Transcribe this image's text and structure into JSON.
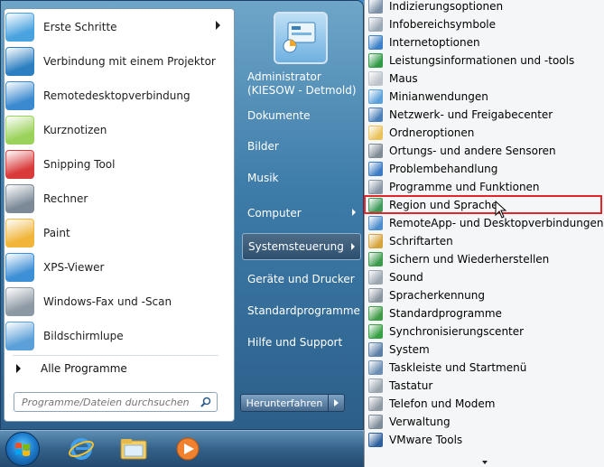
{
  "start_menu": {
    "programs": [
      {
        "label": "Erste Schritte",
        "icon": "getting-started-icon",
        "color": "#4aa3df",
        "has_submenu": true
      },
      {
        "label": "Verbindung mit einem Projektor",
        "icon": "projector-icon",
        "color": "#2d7fc1",
        "has_submenu": false
      },
      {
        "label": "Remotedesktopverbindung",
        "icon": "remote-desktop-icon",
        "color": "#3b8ad0",
        "has_submenu": false
      },
      {
        "label": "Kurznotizen",
        "icon": "sticky-notes-icon",
        "color": "#9bd25b",
        "has_submenu": false
      },
      {
        "label": "Snipping Tool",
        "icon": "scissors-icon",
        "color": "#d93a3a",
        "has_submenu": false
      },
      {
        "label": "Rechner",
        "icon": "calculator-icon",
        "color": "#7c8a98",
        "has_submenu": false
      },
      {
        "label": "Paint",
        "icon": "paint-palette-icon",
        "color": "#f0b53a",
        "has_submenu": false
      },
      {
        "label": "XPS-Viewer",
        "icon": "xps-viewer-icon",
        "color": "#3d8fd6",
        "has_submenu": false
      },
      {
        "label": "Windows-Fax und -Scan",
        "icon": "fax-icon",
        "color": "#8c98a3",
        "has_submenu": false
      },
      {
        "label": "Bildschirmlupe",
        "icon": "magnifier-icon",
        "color": "#5ba0d8",
        "has_submenu": false
      }
    ],
    "all_programs": "Alle Programme",
    "search_placeholder": "Programme/Dateien durchsuchen",
    "username": "Administrator\n(KIESOW - Detmold)",
    "right_links": [
      {
        "label": "Dokumente",
        "has_submenu": false,
        "highlighted": false
      },
      {
        "label": "Bilder",
        "has_submenu": false,
        "highlighted": false
      },
      {
        "label": "Musik",
        "has_submenu": false,
        "highlighted": false
      },
      {
        "label": "Computer",
        "has_submenu": true,
        "highlighted": false
      },
      {
        "label": "Systemsteuerung",
        "has_submenu": true,
        "highlighted": true
      },
      {
        "label": "Geräte und Drucker",
        "has_submenu": false,
        "highlighted": false
      },
      {
        "label": "Standardprogramme",
        "has_submenu": false,
        "highlighted": false
      },
      {
        "label": "Hilfe und Support",
        "has_submenu": false,
        "highlighted": false
      }
    ],
    "shutdown_label": "Herunterfahren"
  },
  "control_panel_menu": {
    "items": [
      {
        "label": "Indizierungsoptionen",
        "color": "#7b8fa6"
      },
      {
        "label": "Infobereichsymbole",
        "color": "#9aa7b5"
      },
      {
        "label": "Internetoptionen",
        "color": "#3a7fc8"
      },
      {
        "label": "Leistungsinformationen und -tools",
        "color": "#2f9a46"
      },
      {
        "label": "Maus",
        "color": "#bcc3ca"
      },
      {
        "label": "Minianwendungen",
        "color": "#5aa0da"
      },
      {
        "label": "Netzwerk- und Freigabecenter",
        "color": "#4a7fb8"
      },
      {
        "label": "Ordneroptionen",
        "color": "#e9c25a"
      },
      {
        "label": "Ortungs- und andere Sensoren",
        "color": "#7f8a95"
      },
      {
        "label": "Problembehandlung",
        "color": "#3d7cc4"
      },
      {
        "label": "Programme und Funktionen",
        "color": "#8896a5"
      },
      {
        "label": "Region und Sprache",
        "color": "#3d9a5a"
      },
      {
        "label": "RemoteApp- und Desktopverbindungen",
        "color": "#4c8ccc"
      },
      {
        "label": "Schriftarten",
        "color": "#d6a33a"
      },
      {
        "label": "Sichern und Wiederherstellen",
        "color": "#3b9a4c"
      },
      {
        "label": "Sound",
        "color": "#9ba6b1"
      },
      {
        "label": "Spracherkennung",
        "color": "#8a95a0"
      },
      {
        "label": "Standardprogramme",
        "color": "#3f9b45"
      },
      {
        "label": "Synchronisierungscenter",
        "color": "#37a043"
      },
      {
        "label": "System",
        "color": "#5b7fa5"
      },
      {
        "label": "Taskleiste und Startmenü",
        "color": "#6b8eb2"
      },
      {
        "label": "Tastatur",
        "color": "#9aa4ae"
      },
      {
        "label": "Telefon und Modem",
        "color": "#8f99a3"
      },
      {
        "label": "Verwaltung",
        "color": "#7e8c99"
      },
      {
        "label": "VMware Tools",
        "color": "#2d5f9c"
      }
    ],
    "highlighted_item": "Region und Sprache"
  },
  "taskbar": {
    "icons": [
      "internet-explorer-icon",
      "explorer-folder-icon",
      "media-player-icon"
    ]
  }
}
